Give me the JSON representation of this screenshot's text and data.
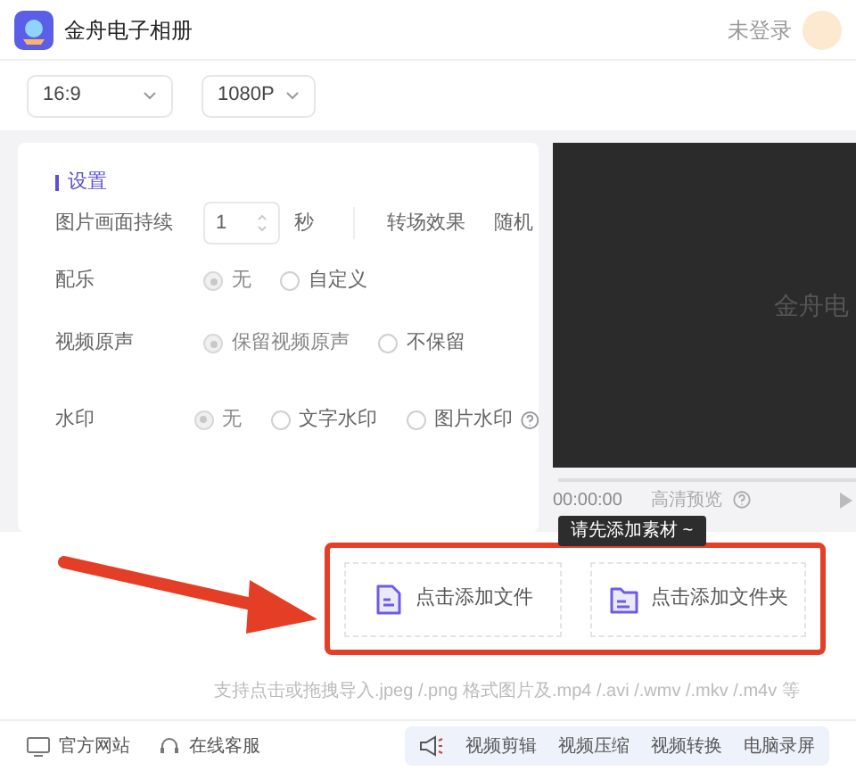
{
  "app": {
    "title": "金舟电子相册",
    "login": "未登录"
  },
  "toolbar": {
    "ratio": "16:9",
    "resolution": "1080P"
  },
  "settings": {
    "title": "设置",
    "duration": {
      "label": "图片画面持续",
      "value": "1",
      "unit": "秒"
    },
    "transition": {
      "label": "转场效果",
      "value": "随机"
    },
    "groups": [
      {
        "label": "配乐",
        "help": false,
        "options": [
          {
            "label": "无",
            "selected": true
          },
          {
            "label": "自定义",
            "selected": false
          }
        ]
      },
      {
        "label": "视频原声",
        "help": false,
        "options": [
          {
            "label": "保留视频原声",
            "selected": true
          },
          {
            "label": "不保留",
            "selected": false
          }
        ]
      },
      {
        "label": "水印",
        "help": true,
        "options": [
          {
            "label": "无",
            "selected": true
          },
          {
            "label": "文字水印",
            "selected": false
          },
          {
            "label": "图片水印",
            "selected": false
          }
        ]
      }
    ]
  },
  "preview": {
    "caption": "金舟电",
    "time": "00:00:00",
    "hd_label": "高清预览"
  },
  "import": {
    "tooltip": "请先添加素材 ~",
    "buttons": [
      {
        "label": "点击添加文件",
        "kind": "file"
      },
      {
        "label": "点击添加文件夹",
        "kind": "folder"
      }
    ],
    "hint": "支持点击或拖拽导入.jpeg /.png 格式图片及.mp4 /.avi /.wmv /.mkv /.m4v 等"
  },
  "footer": {
    "links": [
      {
        "label": "官方网站",
        "kind": "website"
      },
      {
        "label": "在线客服",
        "kind": "support"
      }
    ],
    "tools": [
      "视频剪辑",
      "视频压缩",
      "视频转换",
      "电脑录屏"
    ]
  }
}
